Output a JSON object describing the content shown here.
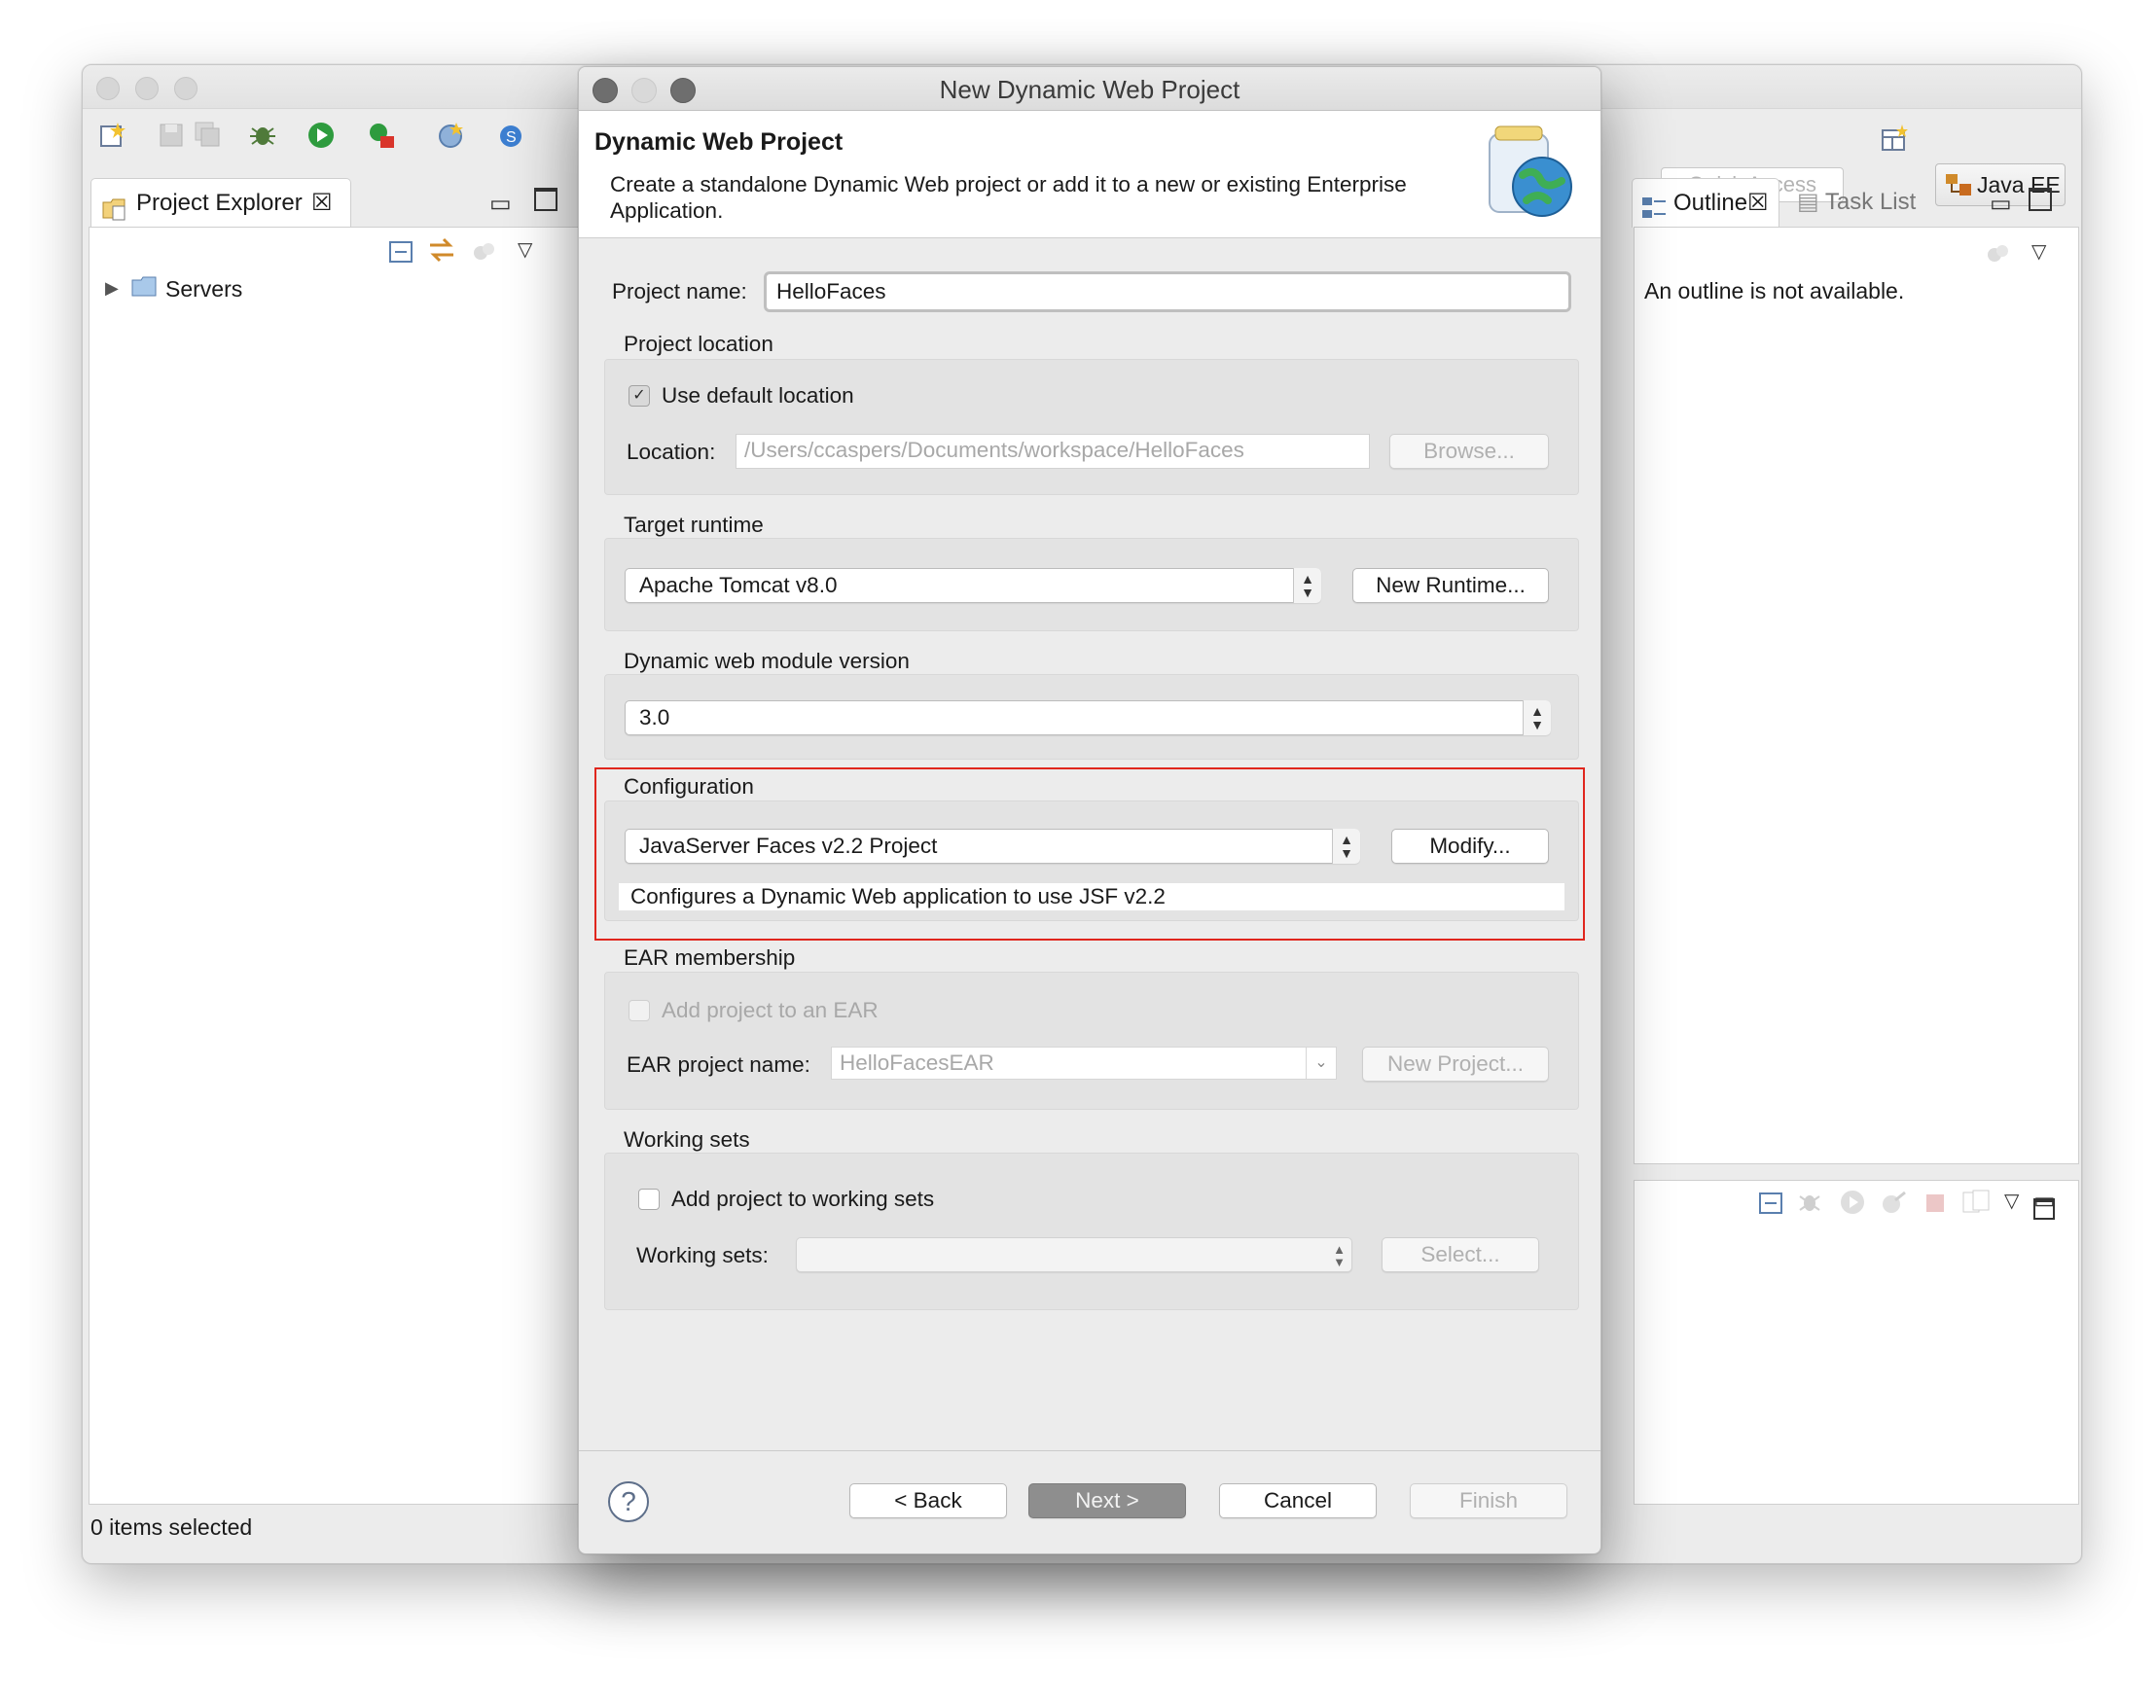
{
  "eclipse": {
    "quick_access_placeholder": "Quick Access",
    "perspective": "Java EE",
    "project_explorer": {
      "tab_label": "Project Explorer",
      "tree": [
        {
          "label": "Servers"
        }
      ]
    },
    "outline": {
      "tab_label": "Outline",
      "task_list_label": "Task List",
      "message": "An outline is not available."
    },
    "status_text": "0 items selected"
  },
  "dialog": {
    "window_title": "New Dynamic Web Project",
    "header_title": "Dynamic Web Project",
    "header_description": "Create a standalone Dynamic Web project or add it to a new or existing Enterprise Application.",
    "project_name_label": "Project name:",
    "project_name_value": "HelloFaces",
    "location": {
      "section_label": "Project location",
      "use_default_label": "Use default location",
      "use_default_checked": true,
      "location_label": "Location:",
      "location_value": "/Users/ccaspers/Documents/workspace/HelloFaces",
      "browse_label": "Browse..."
    },
    "runtime": {
      "section_label": "Target runtime",
      "selected": "Apache Tomcat v8.0",
      "new_runtime_label": "New Runtime..."
    },
    "module_version": {
      "section_label": "Dynamic web module version",
      "selected": "3.0"
    },
    "configuration": {
      "section_label": "Configuration",
      "selected": "JavaServer Faces v2.2 Project",
      "modify_label": "Modify...",
      "description": "Configures a Dynamic Web application to use JSF v2.2"
    },
    "ear": {
      "section_label": "EAR membership",
      "add_label": "Add project to an EAR",
      "add_checked": false,
      "name_label": "EAR project name:",
      "name_value": "HelloFacesEAR",
      "new_project_label": "New Project..."
    },
    "working_sets": {
      "section_label": "Working sets",
      "add_label": "Add project to working sets",
      "add_checked": false,
      "sets_label": "Working sets:",
      "sets_value": "",
      "select_label": "Select..."
    },
    "buttons": {
      "help": "?",
      "back": "< Back",
      "next": "Next >",
      "cancel": "Cancel",
      "finish": "Finish"
    }
  }
}
